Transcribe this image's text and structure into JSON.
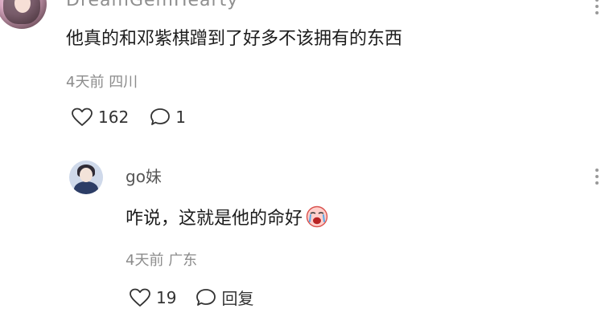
{
  "comments": [
    {
      "username": "DreamGemHearty",
      "text": "他真的和邓紫棋蹭到了好多不该拥有的东西",
      "time": "4天前",
      "location": "四川",
      "likes": "162",
      "replies": "1"
    }
  ],
  "reply": {
    "username": "go妹",
    "text": "咋说，这就是他的命好",
    "emoji": "crying-face",
    "time": "4天前",
    "location": "广东",
    "likes": "19",
    "reply_label": "回复"
  },
  "icons": {
    "like": "heart-outline-icon",
    "comment": "speech-bubble-icon",
    "more": "vertical-ellipsis-icon"
  }
}
